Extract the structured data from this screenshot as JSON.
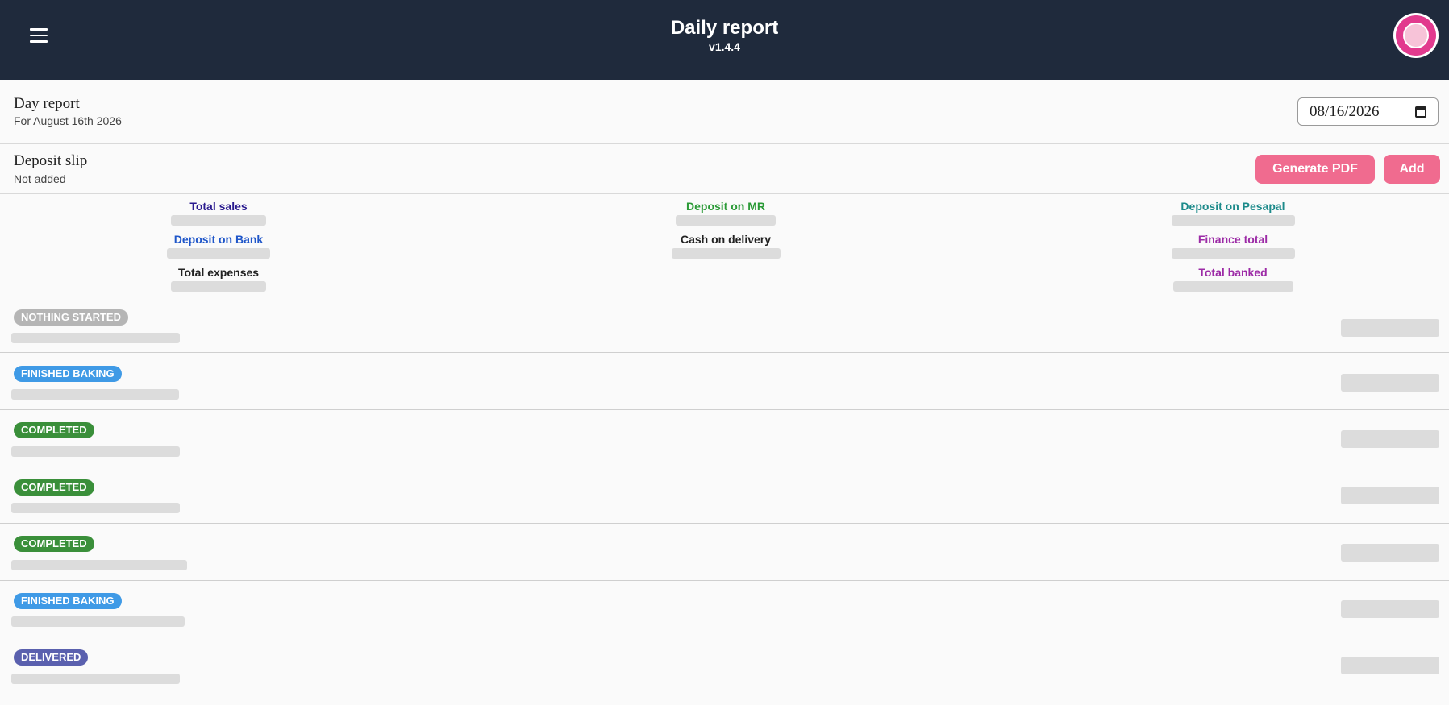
{
  "header": {
    "title": "Daily report",
    "version": "v1.4.4",
    "menu_icon": "hamburger-menu-icon",
    "avatar_icon": "bakery-logo-avatar"
  },
  "day_report": {
    "title": "Day report",
    "subtitle": "For August 16th 2026",
    "date_value": "08/16/2026"
  },
  "deposit_slip": {
    "title": "Deposit slip",
    "status": "Not added",
    "generate_pdf_label": "Generate PDF",
    "add_label": "Add",
    "accent_color": "#f06b8f"
  },
  "stats": [
    {
      "label": "Total sales",
      "color": "#2a1b8f"
    },
    {
      "label": "Deposit on Bank",
      "color": "#1f56c9"
    },
    {
      "label": "Total expenses",
      "color": "#222222"
    },
    {
      "label": "Deposit on MR",
      "color": "#2a9a36"
    },
    {
      "label": "Cash on delivery",
      "color": "#222222"
    },
    {
      "label": "Deposit on Pesapal",
      "color": "#1c8a8a"
    },
    {
      "label": "Finance total",
      "color": "#9c2aa6"
    },
    {
      "label": "Total banked",
      "color": "#9c2aa6"
    }
  ],
  "orders": [
    {
      "status": "NOTHING STARTED",
      "color": "#b5b5b5"
    },
    {
      "status": "FINISHED BAKING",
      "color": "#3f9ae6"
    },
    {
      "status": "COMPLETED",
      "color": "#3a8f3a"
    },
    {
      "status": "COMPLETED",
      "color": "#3a8f3a"
    },
    {
      "status": "COMPLETED",
      "color": "#3a8f3a"
    },
    {
      "status": "FINISHED BAKING",
      "color": "#3f9ae6"
    },
    {
      "status": "DELIVERED",
      "color": "#5a60ae"
    }
  ]
}
